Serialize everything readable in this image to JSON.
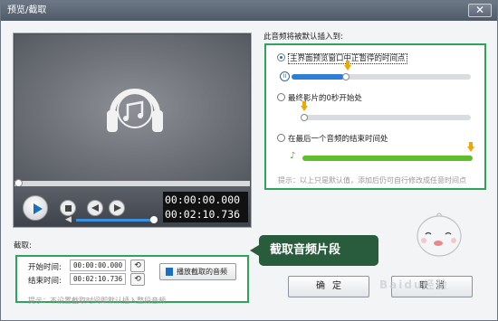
{
  "window": {
    "title": "预览/截取",
    "close_label": "✕"
  },
  "player": {
    "current_time": "00:00:00.000",
    "total_time": "00:02:10.736",
    "seek_tab_glyph": "▾",
    "volume_level": 0.95
  },
  "insert": {
    "title": "此音频将被默认插入到:",
    "options": [
      {
        "label": "主界面预览窗口中正暂停的时间点",
        "selected": true
      },
      {
        "label": "最终影片的0秒开始处",
        "selected": false
      },
      {
        "label": "在最后一个音频的结束时间处",
        "selected": false
      }
    ],
    "hint": "提示：以上只是默认值，添加后仍可自行修改成任意时间点"
  },
  "crop": {
    "title": "截取:",
    "start_label": "开始时间:",
    "start_value": "00:00:00.000",
    "end_label": "结束时间:",
    "end_value": "00:02:10.736",
    "play_button": "播放截取的音频",
    "hint": "提示：不设置截取时间即默认插入整段音频"
  },
  "annotation": {
    "text": "截取音频片段"
  },
  "buttons": {
    "ok": "确定",
    "cancel": "取消"
  },
  "watermark": "Baidu经验",
  "colors": {
    "accent_green": "#2fa35b",
    "accent_blue": "#1b6fc0",
    "marker_orange": "#f0a800"
  }
}
